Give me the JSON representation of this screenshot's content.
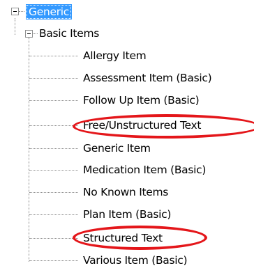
{
  "tree": {
    "root": {
      "label": "Generic",
      "expanded": true,
      "selected": true
    },
    "group": {
      "label": "Basic Items",
      "expanded": true
    },
    "items": [
      {
        "label": "Allergy Item",
        "highlighted": false
      },
      {
        "label": "Assessment Item (Basic)",
        "highlighted": false
      },
      {
        "label": "Follow Up Item (Basic)",
        "highlighted": false
      },
      {
        "label": "Free/Unstructured Text",
        "highlighted": true
      },
      {
        "label": "Generic Item",
        "highlighted": false
      },
      {
        "label": "Medication Item (Basic)",
        "highlighted": false
      },
      {
        "label": "No Known Items",
        "highlighted": false
      },
      {
        "label": "Plan Item (Basic)",
        "highlighted": false
      },
      {
        "label": "Structured Text",
        "highlighted": true
      },
      {
        "label": "Various Item (Basic)",
        "highlighted": false
      }
    ]
  },
  "colors": {
    "selection": "#3399ff",
    "highlight": "#e4161a",
    "connector": "#8a8a8a"
  },
  "icons": {
    "expanded_toggle": "minus-box-icon"
  }
}
